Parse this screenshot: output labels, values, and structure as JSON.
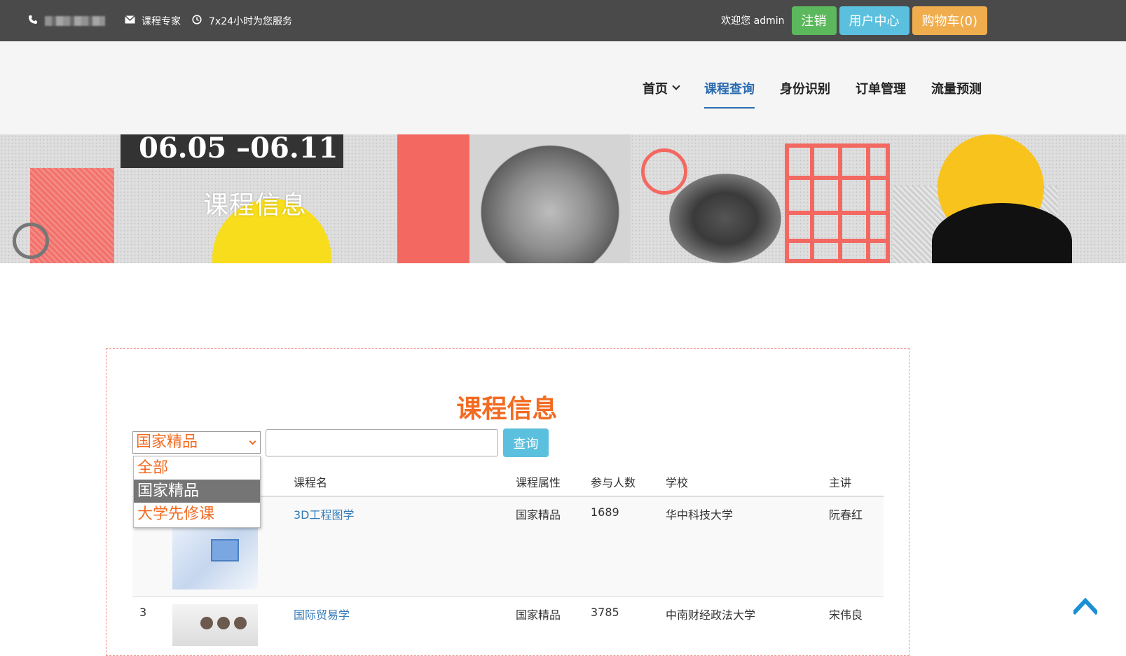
{
  "topbar": {
    "expert_label": "课程专家",
    "service_label": "7x24小时为您服务",
    "welcome": "欢迎您 admin",
    "logout_label": "注销",
    "user_center_label": "用户中心",
    "cart_label": "购物车(0)"
  },
  "nav": {
    "home": "首页",
    "course_query": "课程查询",
    "identity": "身份识别",
    "orders": "订单管理",
    "traffic": "流量预测"
  },
  "banner": {
    "date": "06.05 –06.11",
    "title": "课程信息"
  },
  "section": {
    "title": "课程信息"
  },
  "filter": {
    "selected": "国家精品",
    "options": [
      "全部",
      "国家精品",
      "大学先修课"
    ],
    "search_button": "查询"
  },
  "table": {
    "headers": [
      "课程名",
      "课程属性",
      "参与人数",
      "学校",
      "主讲"
    ],
    "rows": [
      {
        "index": "",
        "name": "3D工程图学",
        "attr": "国家精品",
        "count": "1689",
        "school": "华中科技大学",
        "teacher": "阮春红"
      },
      {
        "index": "3",
        "name": "国际贸易学",
        "attr": "国家精品",
        "count": "3785",
        "school": "中南财经政法大学",
        "teacher": "宋伟良"
      }
    ]
  },
  "colors": {
    "accent_orange": "#f26b22",
    "link_blue": "#337ab7",
    "nav_active": "#2b6cb0"
  }
}
